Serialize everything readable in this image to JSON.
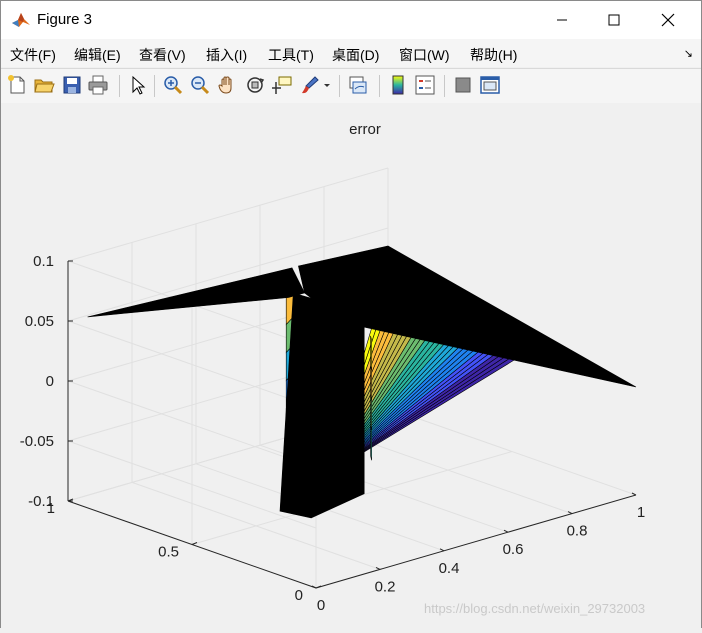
{
  "window": {
    "title": "Figure 3",
    "controls": {
      "minimize": "—",
      "maximize": "☐",
      "close": "✕"
    }
  },
  "menu": {
    "items": [
      {
        "label": "文件(F)"
      },
      {
        "label": "编辑(E)"
      },
      {
        "label": "查看(V)"
      },
      {
        "label": "插入(I)"
      },
      {
        "label": "工具(T)"
      },
      {
        "label": "桌面(D)"
      },
      {
        "label": "窗口(W)"
      },
      {
        "label": "帮助(H)"
      }
    ],
    "dock_glyph": "↘"
  },
  "toolbar": {
    "icons": [
      "new-figure-icon",
      "open-file-icon",
      "save-icon",
      "print-icon",
      "pointer-icon",
      "zoom-in-icon",
      "zoom-out-icon",
      "pan-icon",
      "rotate-3d-icon",
      "data-cursor-icon",
      "brush-icon",
      "link-plot-icon",
      "colorbar-icon",
      "legend-icon",
      "hide-plot-tools-icon",
      "show-plot-tools-icon"
    ]
  },
  "chart_data": {
    "type": "surface",
    "title": "error",
    "xlabel": "",
    "ylabel": "",
    "zlabel": "",
    "xlim": [
      0,
      1
    ],
    "ylim": [
      0,
      1
    ],
    "zlim": [
      -0.1,
      0.1
    ],
    "x_ticks": [
      "0",
      "0.2",
      "0.4",
      "0.6",
      "0.8",
      "1"
    ],
    "y_ticks": [
      "0",
      "0.5",
      "1"
    ],
    "z_ticks": [
      "-0.1",
      "-0.05",
      "0",
      "0.05",
      "0.1"
    ],
    "grid": true,
    "colormap": "parula",
    "description_values": {
      "plateau_z": 0.04,
      "trough_z_min": -0.1
    }
  },
  "watermark": "https://blog.csdn.net/weixin_29732003"
}
